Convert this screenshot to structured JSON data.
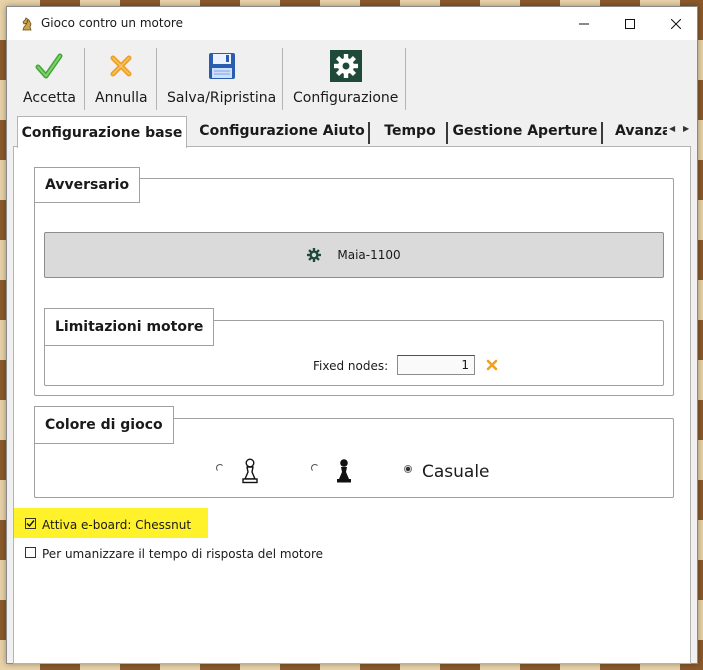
{
  "window": {
    "title": "Gioco contro un motore",
    "controls": {
      "minimize": "minimize-icon",
      "maximize": "maximize-icon",
      "close": "close-icon"
    }
  },
  "toolbar": {
    "items": [
      {
        "label": "Accetta",
        "icon": "checkmark-icon",
        "color": "#3fa535"
      },
      {
        "label": "Annulla",
        "icon": "cancel-x-icon",
        "color": "#f0a020"
      },
      {
        "label": "Salva/Ripristina",
        "icon": "floppy-disk-icon",
        "color": "#2a5db0"
      },
      {
        "label": "Configurazione",
        "icon": "gear-icon",
        "color": "#1f4a3a"
      }
    ]
  },
  "tabs": [
    {
      "label": "Configurazione base",
      "active": true
    },
    {
      "label": "Configurazione Aiuto",
      "active": false
    },
    {
      "label": "Tempo",
      "active": false
    },
    {
      "label": "Gestione Aperture",
      "active": false
    },
    {
      "label": "Avanzate",
      "active": false
    }
  ],
  "opponent": {
    "group_title": "Avversario",
    "engine_name": "Maia-1100",
    "engine_icon": "engine-gear-icon"
  },
  "limits": {
    "group_title": "Limitazioni motore",
    "fixed_nodes_label": "Fixed nodes:",
    "fixed_nodes_value": "1",
    "clear_icon": "clear-x-icon"
  },
  "color": {
    "group_title": "Colore di gioco",
    "options": [
      {
        "icon": "white-pawn-icon",
        "selected": false
      },
      {
        "icon": "black-pawn-icon",
        "selected": false
      },
      {
        "label": "Casuale",
        "selected": true
      }
    ]
  },
  "checkboxes": [
    {
      "label": "Attiva e-board: Chessnut",
      "checked": true,
      "highlight": "#fff22b"
    },
    {
      "label": "Per umanizzare il tempo di risposta del motore",
      "checked": false
    }
  ]
}
